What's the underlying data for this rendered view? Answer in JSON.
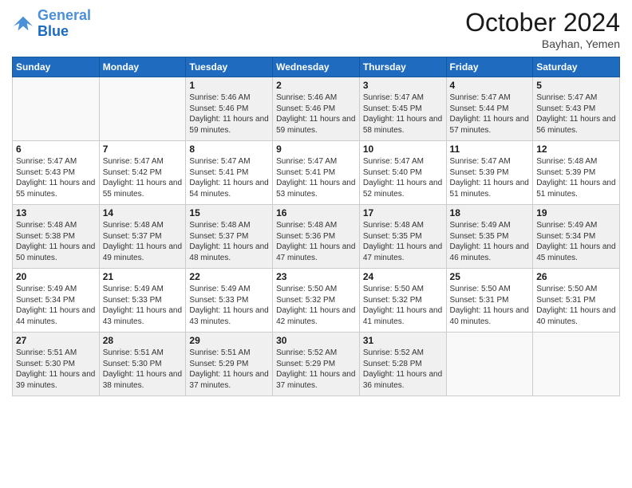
{
  "header": {
    "logo_line1": "General",
    "logo_line2": "Blue",
    "month": "October 2024",
    "location": "Bayhan, Yemen"
  },
  "days_of_week": [
    "Sunday",
    "Monday",
    "Tuesday",
    "Wednesday",
    "Thursday",
    "Friday",
    "Saturday"
  ],
  "weeks": [
    [
      {
        "day": "",
        "info": ""
      },
      {
        "day": "",
        "info": ""
      },
      {
        "day": "1",
        "info": "Sunrise: 5:46 AM\nSunset: 5:46 PM\nDaylight: 11 hours and 59 minutes."
      },
      {
        "day": "2",
        "info": "Sunrise: 5:46 AM\nSunset: 5:46 PM\nDaylight: 11 hours and 59 minutes."
      },
      {
        "day": "3",
        "info": "Sunrise: 5:47 AM\nSunset: 5:45 PM\nDaylight: 11 hours and 58 minutes."
      },
      {
        "day": "4",
        "info": "Sunrise: 5:47 AM\nSunset: 5:44 PM\nDaylight: 11 hours and 57 minutes."
      },
      {
        "day": "5",
        "info": "Sunrise: 5:47 AM\nSunset: 5:43 PM\nDaylight: 11 hours and 56 minutes."
      }
    ],
    [
      {
        "day": "6",
        "info": "Sunrise: 5:47 AM\nSunset: 5:43 PM\nDaylight: 11 hours and 55 minutes."
      },
      {
        "day": "7",
        "info": "Sunrise: 5:47 AM\nSunset: 5:42 PM\nDaylight: 11 hours and 55 minutes."
      },
      {
        "day": "8",
        "info": "Sunrise: 5:47 AM\nSunset: 5:41 PM\nDaylight: 11 hours and 54 minutes."
      },
      {
        "day": "9",
        "info": "Sunrise: 5:47 AM\nSunset: 5:41 PM\nDaylight: 11 hours and 53 minutes."
      },
      {
        "day": "10",
        "info": "Sunrise: 5:47 AM\nSunset: 5:40 PM\nDaylight: 11 hours and 52 minutes."
      },
      {
        "day": "11",
        "info": "Sunrise: 5:47 AM\nSunset: 5:39 PM\nDaylight: 11 hours and 51 minutes."
      },
      {
        "day": "12",
        "info": "Sunrise: 5:48 AM\nSunset: 5:39 PM\nDaylight: 11 hours and 51 minutes."
      }
    ],
    [
      {
        "day": "13",
        "info": "Sunrise: 5:48 AM\nSunset: 5:38 PM\nDaylight: 11 hours and 50 minutes."
      },
      {
        "day": "14",
        "info": "Sunrise: 5:48 AM\nSunset: 5:37 PM\nDaylight: 11 hours and 49 minutes."
      },
      {
        "day": "15",
        "info": "Sunrise: 5:48 AM\nSunset: 5:37 PM\nDaylight: 11 hours and 48 minutes."
      },
      {
        "day": "16",
        "info": "Sunrise: 5:48 AM\nSunset: 5:36 PM\nDaylight: 11 hours and 47 minutes."
      },
      {
        "day": "17",
        "info": "Sunrise: 5:48 AM\nSunset: 5:35 PM\nDaylight: 11 hours and 47 minutes."
      },
      {
        "day": "18",
        "info": "Sunrise: 5:49 AM\nSunset: 5:35 PM\nDaylight: 11 hours and 46 minutes."
      },
      {
        "day": "19",
        "info": "Sunrise: 5:49 AM\nSunset: 5:34 PM\nDaylight: 11 hours and 45 minutes."
      }
    ],
    [
      {
        "day": "20",
        "info": "Sunrise: 5:49 AM\nSunset: 5:34 PM\nDaylight: 11 hours and 44 minutes."
      },
      {
        "day": "21",
        "info": "Sunrise: 5:49 AM\nSunset: 5:33 PM\nDaylight: 11 hours and 43 minutes."
      },
      {
        "day": "22",
        "info": "Sunrise: 5:49 AM\nSunset: 5:33 PM\nDaylight: 11 hours and 43 minutes."
      },
      {
        "day": "23",
        "info": "Sunrise: 5:50 AM\nSunset: 5:32 PM\nDaylight: 11 hours and 42 minutes."
      },
      {
        "day": "24",
        "info": "Sunrise: 5:50 AM\nSunset: 5:32 PM\nDaylight: 11 hours and 41 minutes."
      },
      {
        "day": "25",
        "info": "Sunrise: 5:50 AM\nSunset: 5:31 PM\nDaylight: 11 hours and 40 minutes."
      },
      {
        "day": "26",
        "info": "Sunrise: 5:50 AM\nSunset: 5:31 PM\nDaylight: 11 hours and 40 minutes."
      }
    ],
    [
      {
        "day": "27",
        "info": "Sunrise: 5:51 AM\nSunset: 5:30 PM\nDaylight: 11 hours and 39 minutes."
      },
      {
        "day": "28",
        "info": "Sunrise: 5:51 AM\nSunset: 5:30 PM\nDaylight: 11 hours and 38 minutes."
      },
      {
        "day": "29",
        "info": "Sunrise: 5:51 AM\nSunset: 5:29 PM\nDaylight: 11 hours and 37 minutes."
      },
      {
        "day": "30",
        "info": "Sunrise: 5:52 AM\nSunset: 5:29 PM\nDaylight: 11 hours and 37 minutes."
      },
      {
        "day": "31",
        "info": "Sunrise: 5:52 AM\nSunset: 5:28 PM\nDaylight: 11 hours and 36 minutes."
      },
      {
        "day": "",
        "info": ""
      },
      {
        "day": "",
        "info": ""
      }
    ]
  ]
}
